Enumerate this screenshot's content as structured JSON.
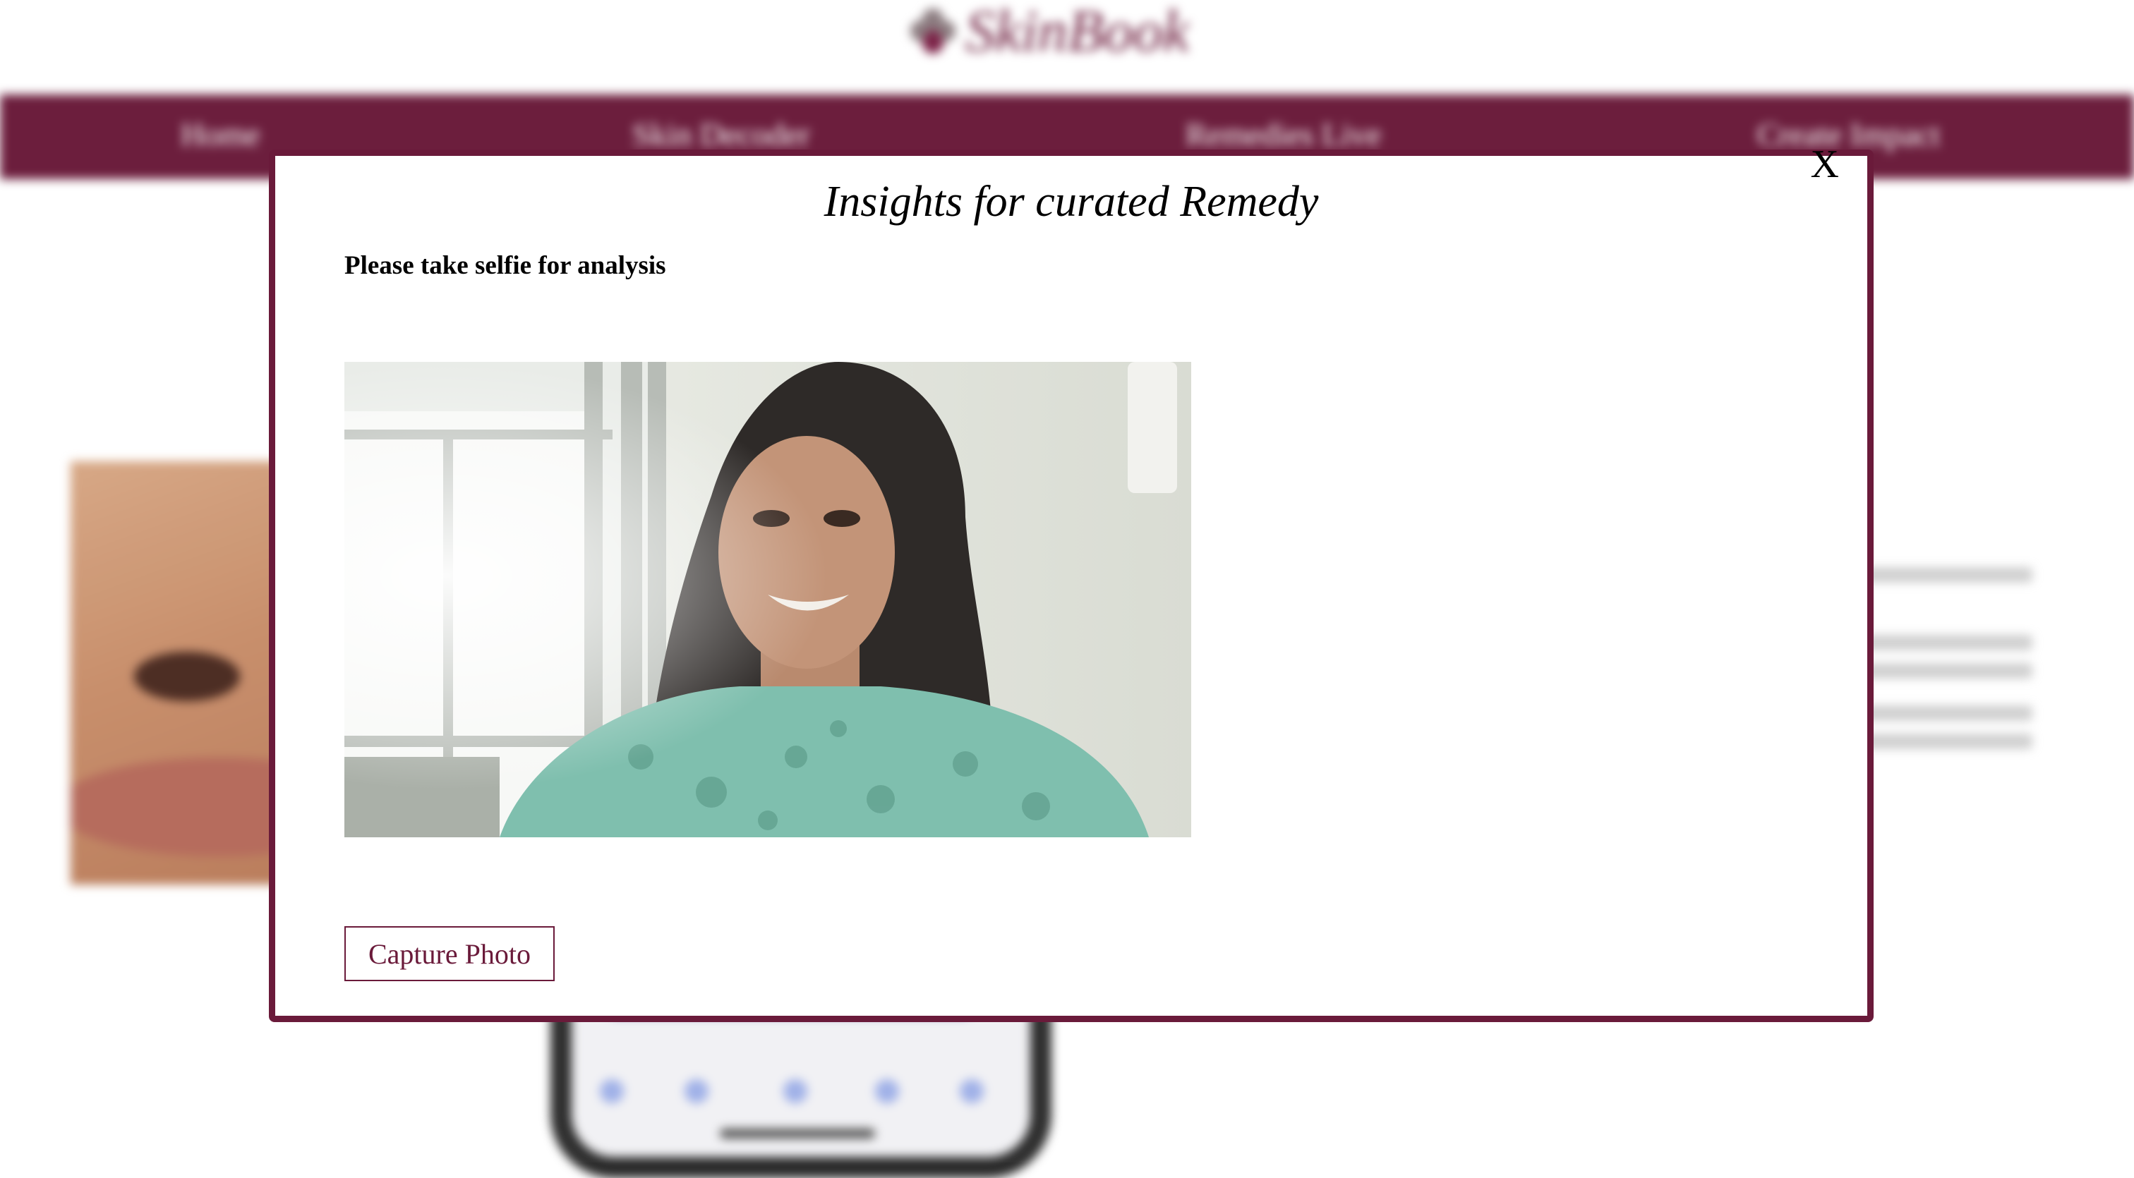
{
  "brand": {
    "name": "SkinBook",
    "logo_icon": "flower-logo-icon"
  },
  "nav": {
    "items": [
      {
        "label": "Home"
      },
      {
        "label": "Skin Decoder"
      },
      {
        "label": "Remedies Live"
      },
      {
        "label": "Create Impact"
      }
    ]
  },
  "modal": {
    "title": "Insights for curated Remedy",
    "close_label": "X",
    "instruction": "Please take selfie for analysis",
    "camera_feed": "live-camera-preview",
    "capture_label": "Capture Photo"
  },
  "colors": {
    "accent": "#6a1a3a",
    "background": "#ffffff",
    "text": "#000000"
  }
}
